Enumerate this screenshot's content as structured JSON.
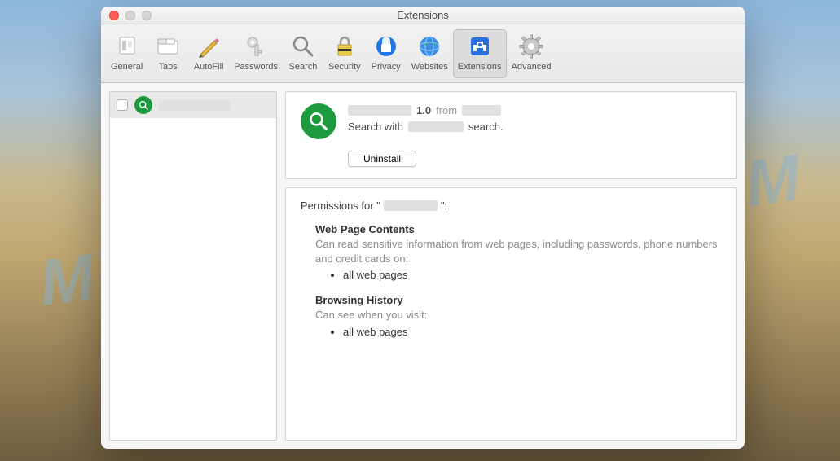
{
  "window": {
    "title": "Extensions"
  },
  "toolbar": {
    "items": [
      {
        "label": "General"
      },
      {
        "label": "Tabs"
      },
      {
        "label": "AutoFill"
      },
      {
        "label": "Passwords"
      },
      {
        "label": "Search"
      },
      {
        "label": "Security"
      },
      {
        "label": "Privacy"
      },
      {
        "label": "Websites"
      },
      {
        "label": "Extensions"
      },
      {
        "label": "Advanced"
      }
    ]
  },
  "detail": {
    "version": "1.0",
    "from_label": "from",
    "desc_prefix": "Search with",
    "desc_suffix": "search.",
    "uninstall_label": "Uninstall"
  },
  "permissions": {
    "title_prefix": "Permissions for \"",
    "title_suffix": "\":",
    "sections": [
      {
        "heading": "Web Page Contents",
        "desc": "Can read sensitive information from web pages, including passwords, phone numbers and credit cards on:",
        "bullets": [
          "all web pages"
        ]
      },
      {
        "heading": "Browsing History",
        "desc": "Can see when you visit:",
        "bullets": [
          "all web pages"
        ]
      }
    ]
  },
  "watermark": "MYANTISPYWARE.COM"
}
